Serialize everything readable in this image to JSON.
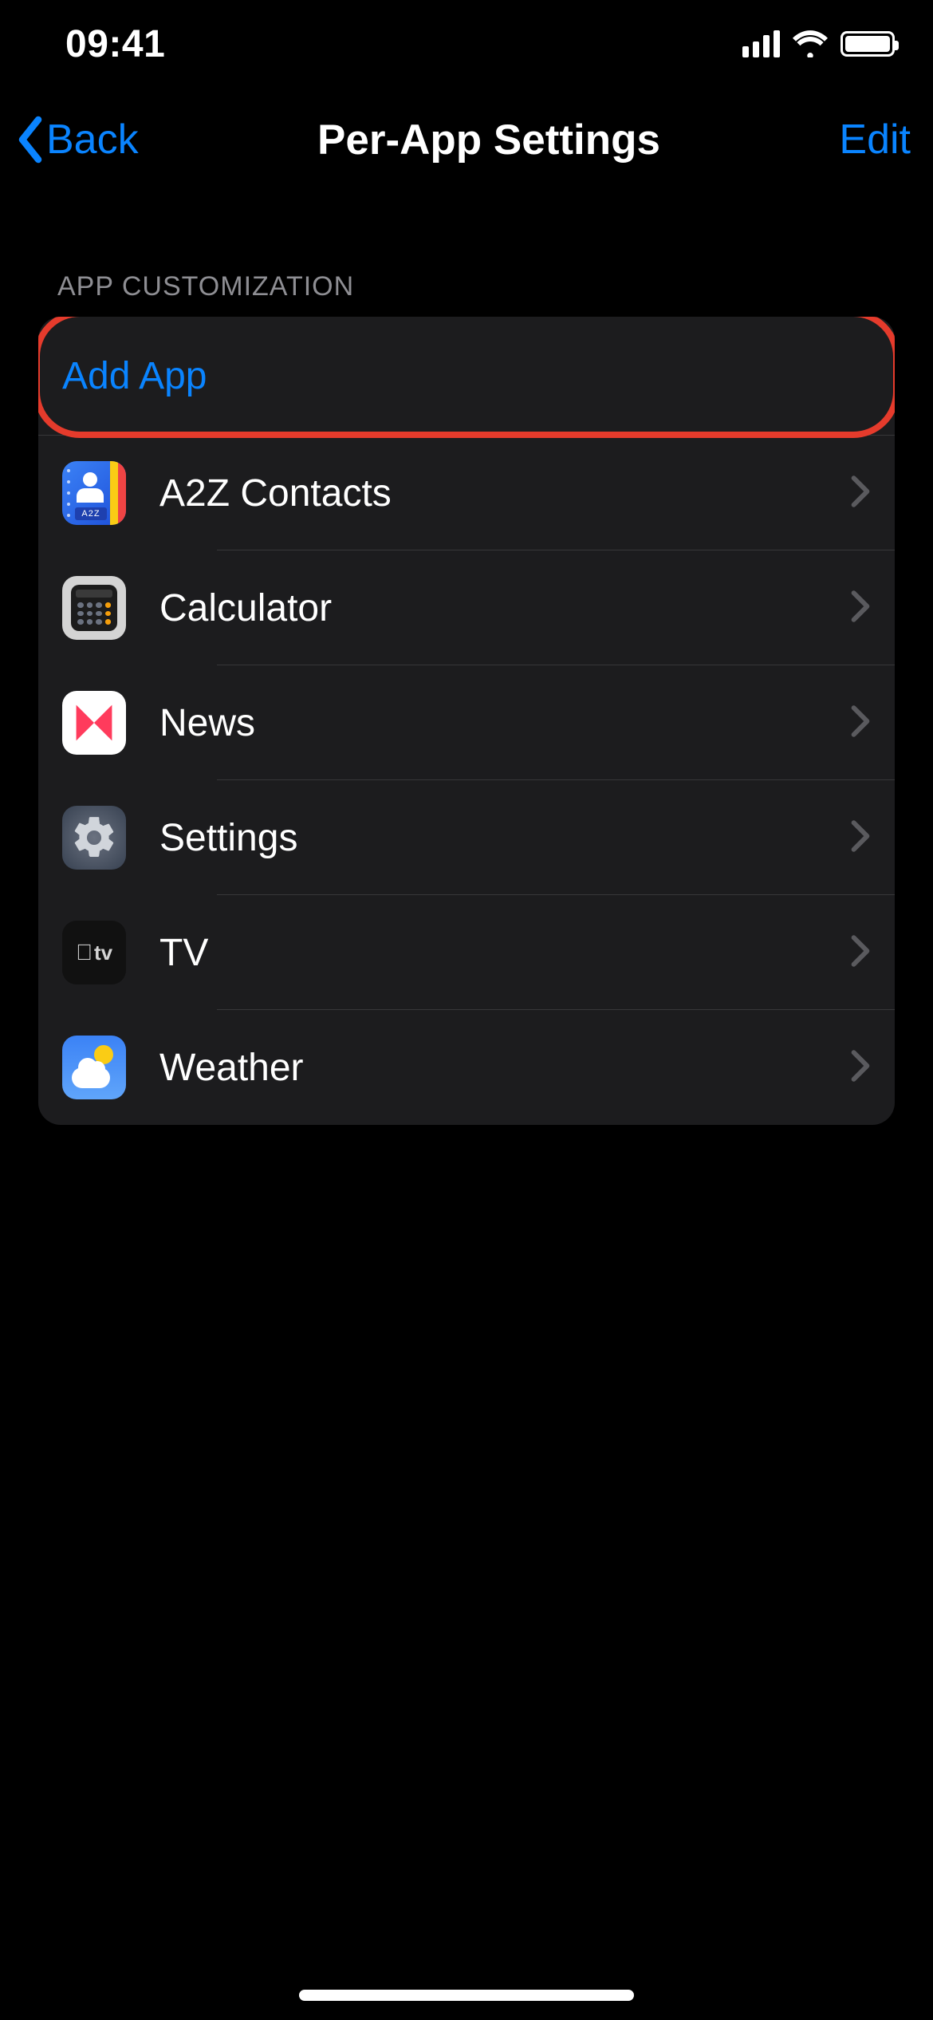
{
  "statusBar": {
    "time": "09:41"
  },
  "nav": {
    "back": "Back",
    "title": "Per-App Settings",
    "edit": "Edit"
  },
  "section": {
    "header": "APP CUSTOMIZATION",
    "addApp": "Add App",
    "apps": [
      {
        "name": "A2Z Contacts",
        "iconTag": "A2Z"
      },
      {
        "name": "Calculator"
      },
      {
        "name": "News"
      },
      {
        "name": "Settings"
      },
      {
        "name": "TV",
        "iconText": "tv"
      },
      {
        "name": "Weather"
      }
    ]
  },
  "annotation": {
    "highlightTarget": "add-app-row"
  }
}
